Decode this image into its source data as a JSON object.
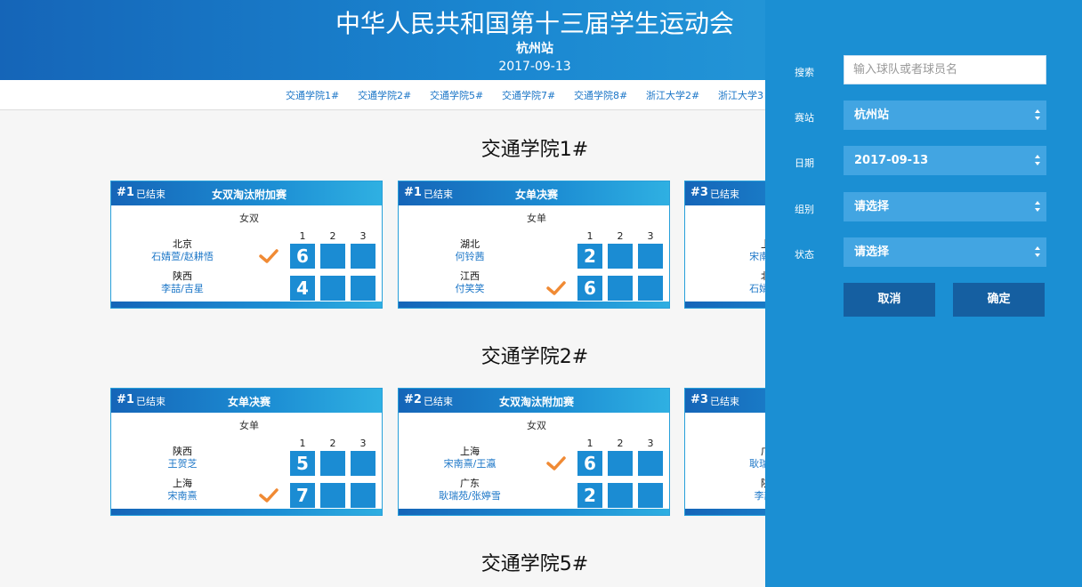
{
  "header": {
    "title": "中华人民共和国第十三届学生运动会",
    "station": "杭州站",
    "date": "2017-09-13"
  },
  "nav": {
    "items": [
      "交通学院1#",
      "交通学院2#",
      "交通学院5#",
      "交通学院7#",
      "交通学院8#",
      "浙江大学2#",
      "浙江大学3"
    ]
  },
  "sections": [
    {
      "title": "交通学院1#",
      "cards": [
        {
          "num": "#1",
          "status": "已结束",
          "event": "女双淘汰附加赛",
          "type": "女双",
          "sets": [
            "1",
            "2",
            "3"
          ],
          "teams": [
            {
              "prov": "北京",
              "players": "石婧萱/赵耕悟",
              "scores": [
                "6",
                "",
                ""
              ],
              "winner": true
            },
            {
              "prov": "陕西",
              "players": "李喆/吉星",
              "scores": [
                "4",
                "",
                ""
              ],
              "winner": false
            }
          ]
        },
        {
          "num": "#1",
          "status": "已结束",
          "event": "女单决赛",
          "type": "女单",
          "sets": [
            "1",
            "2",
            "3"
          ],
          "teams": [
            {
              "prov": "湖北",
              "players": "何铃茜",
              "scores": [
                "2",
                "",
                ""
              ],
              "winner": false
            },
            {
              "prov": "江西",
              "players": "付笑笑",
              "scores": [
                "6",
                "",
                ""
              ],
              "winner": true
            }
          ]
        },
        {
          "num": "#3",
          "status": "已结束",
          "event": "",
          "type": "",
          "sets": [],
          "teams": [
            {
              "prov": "上海",
              "players": "宋南熹/王",
              "scores": [],
              "winner": false
            },
            {
              "prov": "北京",
              "players": "石婧萱/赵",
              "scores": [],
              "winner": false
            }
          ]
        }
      ]
    },
    {
      "title": "交通学院2#",
      "cards": [
        {
          "num": "#1",
          "status": "已结束",
          "event": "女单决赛",
          "type": "女单",
          "sets": [
            "1",
            "2",
            "3"
          ],
          "teams": [
            {
              "prov": "陕西",
              "players": "王贺芝",
              "scores": [
                "5",
                "",
                ""
              ],
              "winner": false
            },
            {
              "prov": "上海",
              "players": "宋南熹",
              "scores": [
                "7",
                "",
                ""
              ],
              "winner": true
            }
          ]
        },
        {
          "num": "#2",
          "status": "已结束",
          "event": "女双淘汰附加赛",
          "type": "女双",
          "sets": [
            "1",
            "2",
            "3"
          ],
          "teams": [
            {
              "prov": "上海",
              "players": "宋南熹/王瀛",
              "scores": [
                "6",
                "",
                ""
              ],
              "winner": true
            },
            {
              "prov": "广东",
              "players": "耿瑞苑/张婷雪",
              "scores": [
                "2",
                "",
                ""
              ],
              "winner": false
            }
          ]
        },
        {
          "num": "#3",
          "status": "已结束",
          "event": "",
          "type": "",
          "sets": [],
          "teams": [
            {
              "prov": "广东",
              "players": "耿瑞苑/张",
              "scores": [],
              "winner": false
            },
            {
              "prov": "陕西",
              "players": "李喆/吉",
              "scores": [],
              "winner": false
            }
          ]
        }
      ]
    },
    {
      "title": "交通学院5#",
      "cards": []
    }
  ],
  "filter": {
    "search_label": "搜索",
    "search_placeholder": "输入球队或者球员名",
    "station_label": "赛站",
    "station_value": "杭州站",
    "date_label": "日期",
    "date_value": "2017-09-13",
    "group_label": "组别",
    "group_value": "请选择",
    "status_label": "状态",
    "status_value": "请选择",
    "cancel": "取消",
    "confirm": "确定"
  },
  "colors": {
    "header_blue": "#1a86d0",
    "score_blue": "#1b8cd3",
    "panel_blue": "#1b8fd3",
    "button_dark": "#155fa1",
    "check_orange": "#f08a34",
    "link_blue": "#1a75c7"
  }
}
